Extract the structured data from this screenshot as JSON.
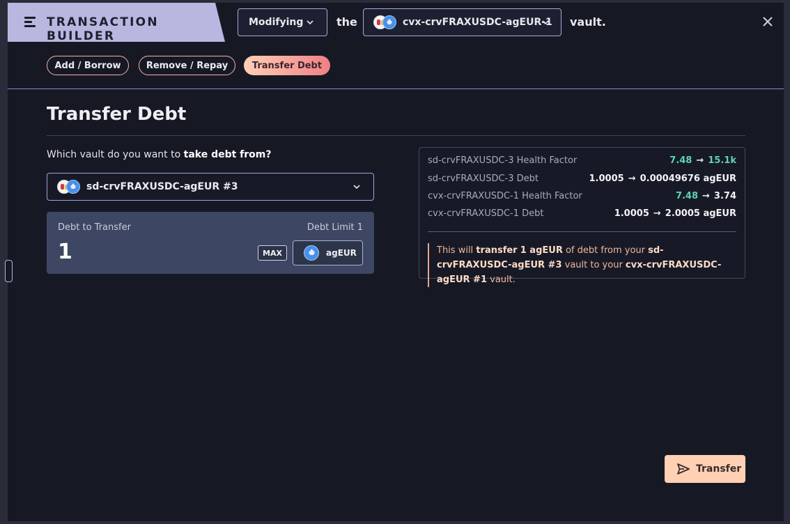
{
  "header": {
    "title": "TRANSACTION BUILDER",
    "mode": "Modifying",
    "word_the": "the",
    "vault": "cvx-crvFRAXUSDC-agEUR-1",
    "word_vault": "vault."
  },
  "tabs": [
    {
      "label": "Add / Borrow",
      "active": false
    },
    {
      "label": "Remove / Repay",
      "active": false
    },
    {
      "label": "Transfer Debt",
      "active": true
    }
  ],
  "main": {
    "title": "Transfer Debt",
    "question_prefix": "Which vault do you want to ",
    "question_bold": "take debt from?",
    "from_vault": "sd-crvFRAXUSDC-agEUR #3",
    "debt_label": "Debt to Transfer",
    "debt_limit": "Debt Limit 1",
    "debt_value": "1",
    "max_label": "MAX",
    "token": "agEUR"
  },
  "summary": {
    "rows": [
      {
        "label": "sd-crvFRAXUSDC-3 Health Factor",
        "from": "7.48",
        "to": "15.1k"
      },
      {
        "label": "sd-crvFRAXUSDC-3 Debt",
        "from": "1.0005",
        "to": "0.00049676 agEUR"
      },
      {
        "label": "cvx-crvFRAXUSDC-1 Health Factor",
        "from": "7.48",
        "to": "3.74"
      },
      {
        "label": "cvx-crvFRAXUSDC-1 Debt",
        "from": "1.0005",
        "to": "2.0005 agEUR"
      }
    ],
    "arrow": "→",
    "note": {
      "t1": "This will ",
      "b1": "transfer",
      "t2": " ",
      "b2": "1 agEUR",
      "t3": " of debt from your ",
      "b3": "sd-crvFRAXUSDC-agEUR #3",
      "t4": " vault to your ",
      "b4": "cvx-crvFRAXUSDC-agEUR #1",
      "t5": " vault."
    }
  },
  "actions": {
    "transfer_label": "Transfer"
  },
  "colors": {
    "accent_gradient_start": "#ffd0b5",
    "accent_gradient_end": "#f07f85",
    "positive": "#5fd3b4",
    "panel_bg": "#161924",
    "title_bar": "#b7b7e0"
  }
}
